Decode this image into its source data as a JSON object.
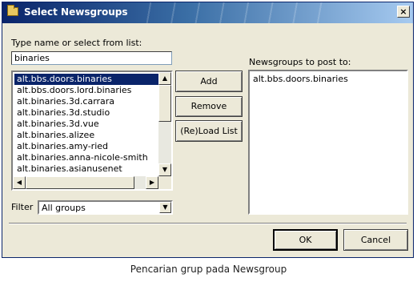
{
  "window": {
    "title": "Select Newsgroups",
    "close_glyph": "×"
  },
  "search": {
    "label": "Type name or select from list:",
    "value": "binaries"
  },
  "available_list": {
    "items": [
      "alt.bbs.doors.binaries",
      "alt.bbs.doors.lord.binaries",
      "alt.binaries.3d.carrara",
      "alt.binaries.3d.studio",
      "alt.binaries.3d.vue",
      "alt.binaries.alizee",
      "alt.binaries.amy-ried",
      "alt.binaries.anna-nicole-smith",
      "alt.binaries.asianusenet"
    ],
    "selected_index": 0
  },
  "buttons": {
    "add": "Add",
    "remove": "Remove",
    "reload": "(Re)Load List",
    "ok": "OK",
    "cancel": "Cancel"
  },
  "post_to": {
    "label": "Newsgroups to post to:",
    "items": [
      "alt.bbs.doors.binaries"
    ]
  },
  "filter": {
    "label": "Filter",
    "value": "All groups"
  },
  "caption": "Pencarian grup pada Newsgroup"
}
